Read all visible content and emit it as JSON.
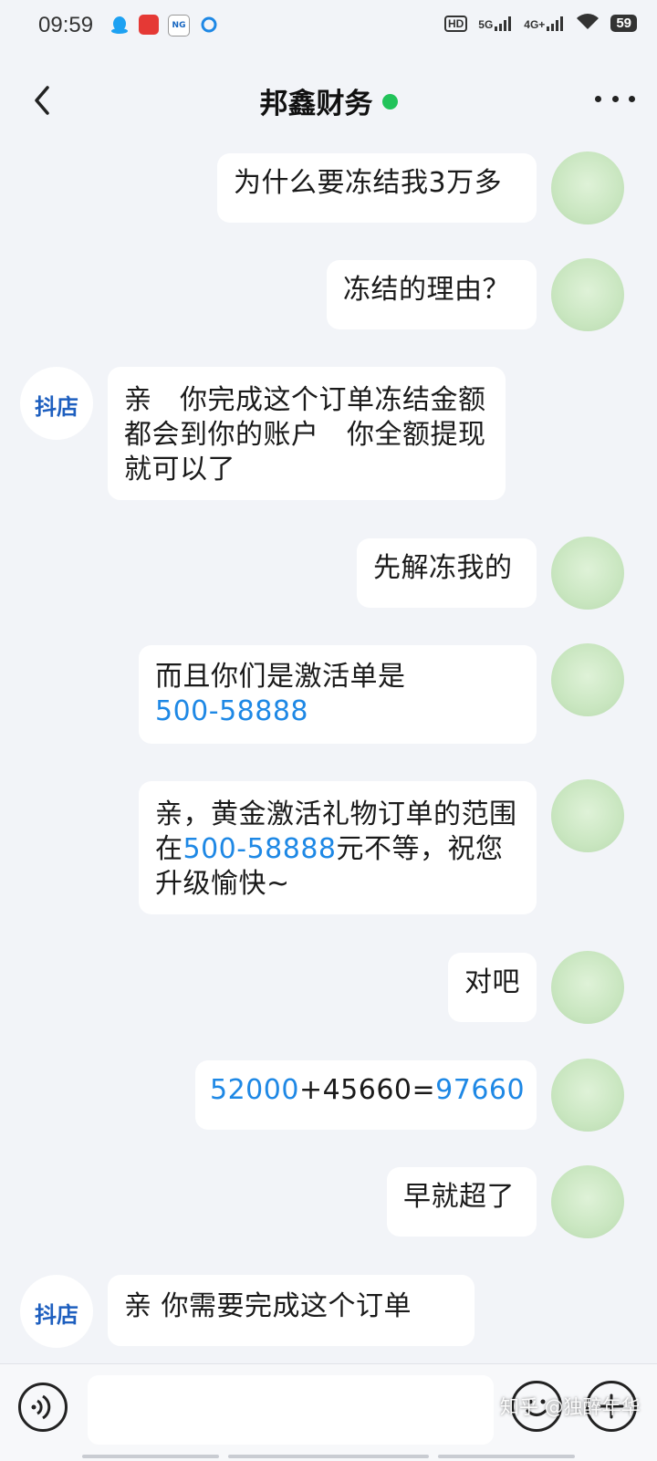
{
  "status_bar": {
    "time": "09:59",
    "signal_5g": "5G",
    "signal_4g": "4G+",
    "hd": "HD",
    "battery": "59"
  },
  "header": {
    "title": "邦鑫财务",
    "online_color": "#22c35a"
  },
  "messages": [
    {
      "from": "me",
      "parts": [
        {
          "text": "为什么要冻结我3万多"
        }
      ]
    },
    {
      "from": "me",
      "parts": [
        {
          "text": "冻结的理由？"
        }
      ]
    },
    {
      "from": "shop",
      "parts": [
        {
          "text": "亲　你完成这个订单冻结金额都会到你的账户　你全额提现就可以了"
        }
      ]
    },
    {
      "from": "me",
      "parts": [
        {
          "text": "先解冻我的"
        }
      ]
    },
    {
      "from": "me",
      "parts": [
        {
          "text": "而且你们是激活单是"
        },
        {
          "text": "500-58888",
          "link": true
        }
      ]
    },
    {
      "from": "me",
      "parts": [
        {
          "text": "亲，黄金激活礼物订单的范围在"
        },
        {
          "text": "500-58888",
          "link": true
        },
        {
          "text": "元不等，祝您升级愉快~"
        }
      ]
    },
    {
      "from": "me",
      "parts": [
        {
          "text": "对吧"
        }
      ]
    },
    {
      "from": "me",
      "parts": [
        {
          "text": "52000",
          "link": true
        },
        {
          "text": "+45660="
        },
        {
          "text": "97660",
          "link": true
        }
      ]
    },
    {
      "from": "me",
      "parts": [
        {
          "text": "早就超了"
        }
      ]
    },
    {
      "from": "shop",
      "parts": [
        {
          "text": "亲  你需要完成这个订单"
        }
      ]
    }
  ],
  "shop_avatar_label": "抖店",
  "input": {
    "placeholder": "",
    "value": ""
  },
  "watermark": "知乎 @独醉年华",
  "colors": {
    "link": "#1e88e5",
    "background": "#f2f4f8",
    "bubble": "#ffffff"
  }
}
